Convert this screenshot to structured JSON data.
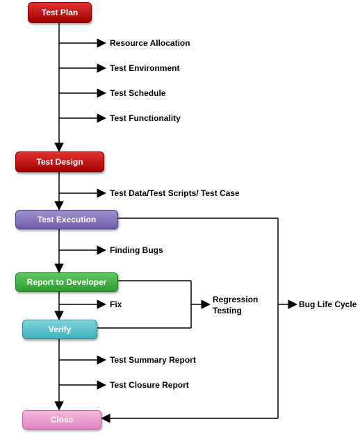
{
  "nodes": {
    "test_plan": "Test Plan",
    "test_design": "Test Design",
    "test_execution": "Test Execution",
    "report_dev": "Report to Developer",
    "verify": "Verify",
    "close": "Close"
  },
  "labels": {
    "resource_alloc": "Resource Allocation",
    "test_env": "Test Environment",
    "test_sched": "Test Schedule",
    "test_func": "Test Functionality",
    "test_data": "Test Data/Test Scripts/ Test Case",
    "finding_bugs": "Finding Bugs",
    "fix": "Fix",
    "regression": "Regression Testing",
    "test_summary": "Test Summary Report",
    "test_closure": "Test Closure Report",
    "bug_life": "Bug Life Cycle"
  }
}
